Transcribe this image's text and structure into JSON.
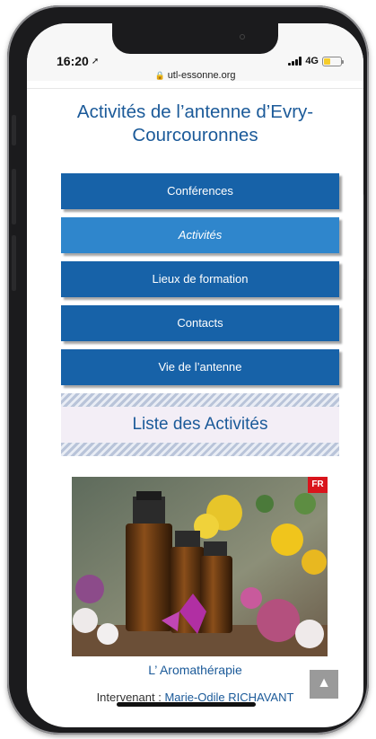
{
  "status_bar": {
    "time": "16:20",
    "network": "4G",
    "url": "utl-essonne.org",
    "battery_level": 0.4,
    "battery_color": "#f5cc2a"
  },
  "page": {
    "title": "Activités de l’antenne d’Evry-Courcouronnes"
  },
  "nav": {
    "items": [
      {
        "label": "Conférences",
        "active": false
      },
      {
        "label": "Activités",
        "active": true
      },
      {
        "label": "Lieux de formation",
        "active": false
      },
      {
        "label": "Contacts",
        "active": false
      },
      {
        "label": "Vie de l’antenne",
        "active": false
      }
    ]
  },
  "section": {
    "heading": "Liste des Activités"
  },
  "activity": {
    "language_badge": "FR",
    "title": "L’ Aromathérapie",
    "speaker_prefix": "Intervenant : ",
    "speaker_name": "Marie-Odile RICHAVANT"
  },
  "colors": {
    "accent": "#1762a8",
    "active": "#2f86cc",
    "title": "#1b5a99",
    "badge": "#d9141c"
  },
  "icons": {
    "location": "location-arrow-icon",
    "lock": "lock-icon",
    "scroll_top": "triangle-up-icon"
  }
}
